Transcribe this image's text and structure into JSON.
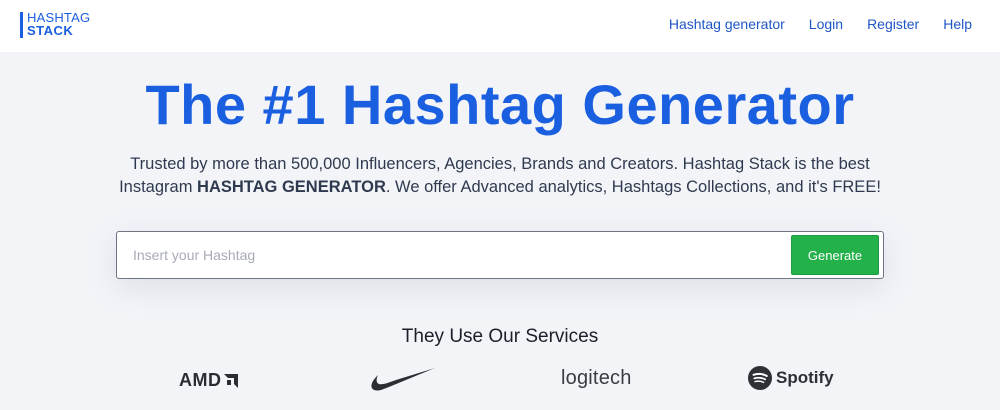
{
  "header": {
    "logo_line1": "HASHTAG",
    "logo_line2": "STACK",
    "nav": [
      "Hashtag generator",
      "Login",
      "Register",
      "Help"
    ]
  },
  "hero": {
    "title": "The #1 Hashtag Generator",
    "subtitle_line1": "Trusted by more than 500,000 Influencers, Agencies, Brands and Creators. Hashtag Stack is the best",
    "subtitle_line2_pre": "Instagram ",
    "subtitle_line2_bold": "HASHTAG GENERATOR",
    "subtitle_line2_post": ". We offer Advanced analytics, Hashtags Collections, and it's FREE!"
  },
  "search": {
    "placeholder": "Insert your Hashtag",
    "value": "",
    "button_label": "Generate"
  },
  "services": {
    "title": "They Use Our Services",
    "brands": [
      "AMD",
      "nike",
      "logitech",
      "Spotify"
    ]
  },
  "colors": {
    "accent": "#1a5fe0",
    "button": "#23b14a",
    "background": "#f3f4f8"
  }
}
